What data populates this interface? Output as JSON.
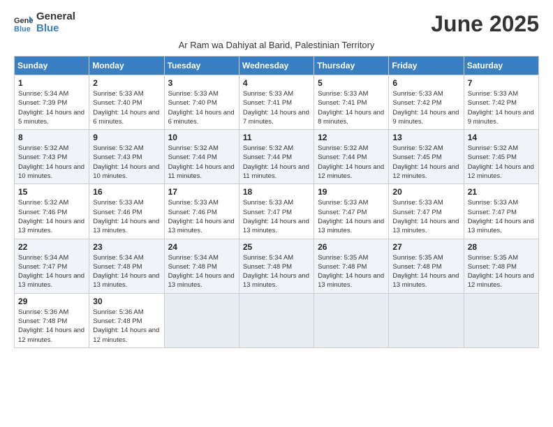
{
  "logo": {
    "text_general": "General",
    "text_blue": "Blue"
  },
  "title": "June 2025",
  "subtitle": "Ar Ram wa Dahiyat al Barid, Palestinian Territory",
  "days_of_week": [
    "Sunday",
    "Monday",
    "Tuesday",
    "Wednesday",
    "Thursday",
    "Friday",
    "Saturday"
  ],
  "weeks": [
    [
      {
        "day": "1",
        "sunrise": "5:34 AM",
        "sunset": "7:39 PM",
        "daylight": "14 hours and 5 minutes."
      },
      {
        "day": "2",
        "sunrise": "5:33 AM",
        "sunset": "7:40 PM",
        "daylight": "14 hours and 6 minutes."
      },
      {
        "day": "3",
        "sunrise": "5:33 AM",
        "sunset": "7:40 PM",
        "daylight": "14 hours and 6 minutes."
      },
      {
        "day": "4",
        "sunrise": "5:33 AM",
        "sunset": "7:41 PM",
        "daylight": "14 hours and 7 minutes."
      },
      {
        "day": "5",
        "sunrise": "5:33 AM",
        "sunset": "7:41 PM",
        "daylight": "14 hours and 8 minutes."
      },
      {
        "day": "6",
        "sunrise": "5:33 AM",
        "sunset": "7:42 PM",
        "daylight": "14 hours and 9 minutes."
      },
      {
        "day": "7",
        "sunrise": "5:33 AM",
        "sunset": "7:42 PM",
        "daylight": "14 hours and 9 minutes."
      }
    ],
    [
      {
        "day": "8",
        "sunrise": "5:32 AM",
        "sunset": "7:43 PM",
        "daylight": "14 hours and 10 minutes."
      },
      {
        "day": "9",
        "sunrise": "5:32 AM",
        "sunset": "7:43 PM",
        "daylight": "14 hours and 10 minutes."
      },
      {
        "day": "10",
        "sunrise": "5:32 AM",
        "sunset": "7:44 PM",
        "daylight": "14 hours and 11 minutes."
      },
      {
        "day": "11",
        "sunrise": "5:32 AM",
        "sunset": "7:44 PM",
        "daylight": "14 hours and 11 minutes."
      },
      {
        "day": "12",
        "sunrise": "5:32 AM",
        "sunset": "7:44 PM",
        "daylight": "14 hours and 12 minutes."
      },
      {
        "day": "13",
        "sunrise": "5:32 AM",
        "sunset": "7:45 PM",
        "daylight": "14 hours and 12 minutes."
      },
      {
        "day": "14",
        "sunrise": "5:32 AM",
        "sunset": "7:45 PM",
        "daylight": "14 hours and 12 minutes."
      }
    ],
    [
      {
        "day": "15",
        "sunrise": "5:32 AM",
        "sunset": "7:46 PM",
        "daylight": "14 hours and 13 minutes."
      },
      {
        "day": "16",
        "sunrise": "5:33 AM",
        "sunset": "7:46 PM",
        "daylight": "14 hours and 13 minutes."
      },
      {
        "day": "17",
        "sunrise": "5:33 AM",
        "sunset": "7:46 PM",
        "daylight": "14 hours and 13 minutes."
      },
      {
        "day": "18",
        "sunrise": "5:33 AM",
        "sunset": "7:47 PM",
        "daylight": "14 hours and 13 minutes."
      },
      {
        "day": "19",
        "sunrise": "5:33 AM",
        "sunset": "7:47 PM",
        "daylight": "14 hours and 13 minutes."
      },
      {
        "day": "20",
        "sunrise": "5:33 AM",
        "sunset": "7:47 PM",
        "daylight": "14 hours and 13 minutes."
      },
      {
        "day": "21",
        "sunrise": "5:33 AM",
        "sunset": "7:47 PM",
        "daylight": "14 hours and 13 minutes."
      }
    ],
    [
      {
        "day": "22",
        "sunrise": "5:34 AM",
        "sunset": "7:47 PM",
        "daylight": "14 hours and 13 minutes."
      },
      {
        "day": "23",
        "sunrise": "5:34 AM",
        "sunset": "7:48 PM",
        "daylight": "14 hours and 13 minutes."
      },
      {
        "day": "24",
        "sunrise": "5:34 AM",
        "sunset": "7:48 PM",
        "daylight": "14 hours and 13 minutes."
      },
      {
        "day": "25",
        "sunrise": "5:34 AM",
        "sunset": "7:48 PM",
        "daylight": "14 hours and 13 minutes."
      },
      {
        "day": "26",
        "sunrise": "5:35 AM",
        "sunset": "7:48 PM",
        "daylight": "14 hours and 13 minutes."
      },
      {
        "day": "27",
        "sunrise": "5:35 AM",
        "sunset": "7:48 PM",
        "daylight": "14 hours and 13 minutes."
      },
      {
        "day": "28",
        "sunrise": "5:35 AM",
        "sunset": "7:48 PM",
        "daylight": "14 hours and 12 minutes."
      }
    ],
    [
      {
        "day": "29",
        "sunrise": "5:36 AM",
        "sunset": "7:48 PM",
        "daylight": "14 hours and 12 minutes."
      },
      {
        "day": "30",
        "sunrise": "5:36 AM",
        "sunset": "7:48 PM",
        "daylight": "14 hours and 12 minutes."
      },
      null,
      null,
      null,
      null,
      null
    ]
  ],
  "labels": {
    "sunrise": "Sunrise:",
    "sunset": "Sunset:",
    "daylight": "Daylight:"
  }
}
